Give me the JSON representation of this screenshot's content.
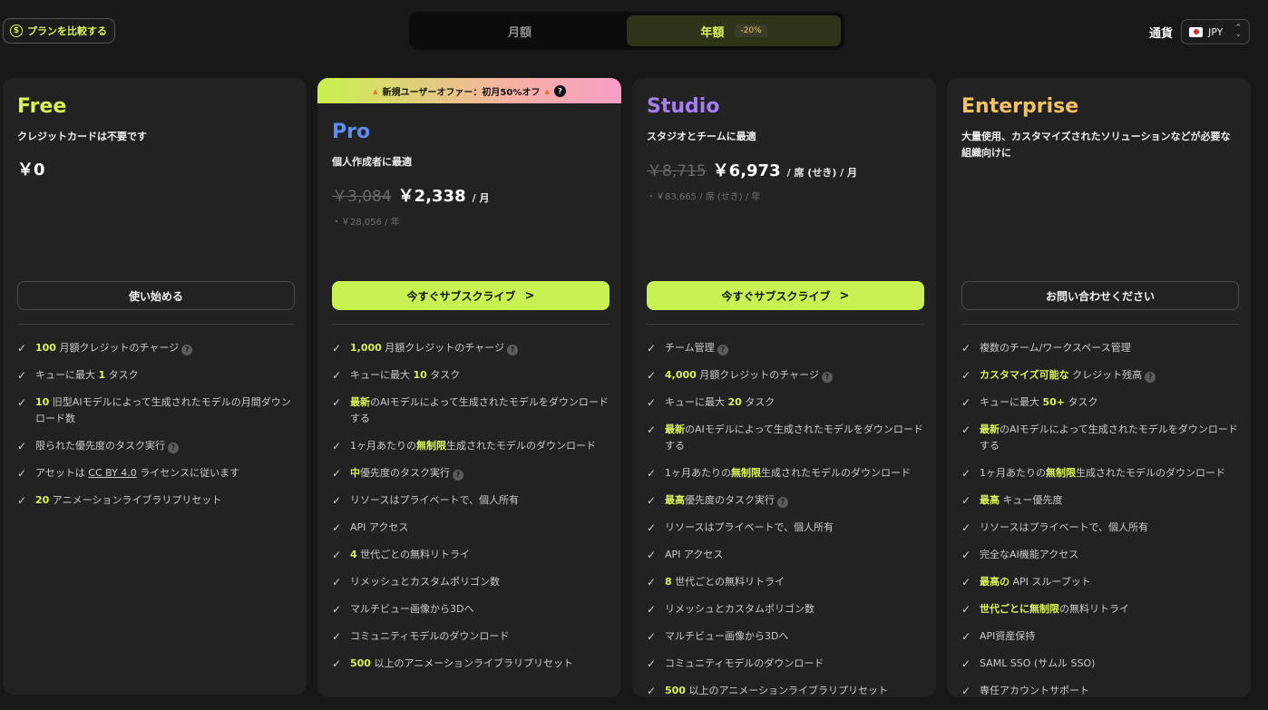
{
  "header": {
    "compare_label": "プランを比較する",
    "billing": {
      "monthly": "月額",
      "yearly": "年額",
      "yearly_badge": "-20%",
      "active": "yearly"
    },
    "currency": {
      "label": "通貨",
      "value": "JPY"
    }
  },
  "colors": {
    "accent": "#c8f251",
    "free": "#d7f35a",
    "pro": "#5f8cf5",
    "studio": "#a77ef7",
    "enterprise": "#f2c166"
  },
  "plans": {
    "free": {
      "name": "Free",
      "desc": "クレジットカードは不要です",
      "price": "￥0",
      "cta": "使い始める",
      "features": [
        [
          {
            "t": "100",
            "h": true
          },
          {
            "t": " 月額クレジットのチャージ"
          },
          {
            "i": true
          }
        ],
        [
          {
            "t": "キューに最大 "
          },
          {
            "t": "1",
            "h": true
          },
          {
            "t": " タスク"
          }
        ],
        [
          {
            "t": "10",
            "h": true
          },
          {
            "t": " 旧型AIモデルによって生成されたモデルの月間ダウンロード数"
          }
        ],
        [
          {
            "t": "限られた優先度のタスク実行"
          },
          {
            "i": true
          }
        ],
        [
          {
            "t": "アセットは "
          },
          {
            "t": "CC BY 4.0",
            "u": true
          },
          {
            "t": " ライセンスに従います"
          }
        ],
        [
          {
            "t": "20",
            "h": true
          },
          {
            "t": " アニメーションライブラリプリセット"
          }
        ]
      ]
    },
    "pro": {
      "offer": "新規ユーザーオファー：初月50%オフ",
      "name": "Pro",
      "desc": "個人作成者に最適",
      "price_old": "￥3,084",
      "price_new": "￥2,338",
      "per": "/ 月",
      "sub": "・￥28,056 / 年",
      "cta": "今すぐサブスクライブ",
      "features": [
        [
          {
            "t": "1,000",
            "h": true
          },
          {
            "t": " 月額クレジットのチャージ"
          },
          {
            "i": true
          }
        ],
        [
          {
            "t": "キューに最大 "
          },
          {
            "t": "10",
            "h": true
          },
          {
            "t": " タスク"
          }
        ],
        [
          {
            "t": "最新",
            "h": true
          },
          {
            "t": "のAIモデルによって生成されたモデルをダウンロードする"
          }
        ],
        [
          {
            "t": "1ヶ月あたりの"
          },
          {
            "t": "無制限",
            "h": true
          },
          {
            "t": "生成されたモデルのダウンロード"
          }
        ],
        [
          {
            "t": "中",
            "h": true
          },
          {
            "t": "優先度のタスク実行"
          },
          {
            "i": true
          }
        ],
        [
          {
            "t": "リソースはプライベートで、個人所有"
          }
        ],
        [
          {
            "t": "API アクセス"
          }
        ],
        [
          {
            "t": "4",
            "h": true
          },
          {
            "t": " 世代ごとの無料リトライ"
          }
        ],
        [
          {
            "t": "リメッシュとカスタムポリゴン数"
          }
        ],
        [
          {
            "t": "マルチビュー画像から3Dへ"
          }
        ],
        [
          {
            "t": "コミュニティモデルのダウンロード"
          }
        ],
        [
          {
            "t": "500",
            "h": true
          },
          {
            "t": " 以上のアニメーションライブラリプリセット"
          }
        ]
      ]
    },
    "studio": {
      "name": "Studio",
      "desc": "スタジオとチームに最適",
      "price_old": "￥8,715",
      "price_new": "￥6,973",
      "per": "/ 席 (せき) / 月",
      "sub": "・￥83,665 / 席 (せき) / 年",
      "cta": "今すぐサブスクライブ",
      "features": [
        [
          {
            "t": "チーム管理"
          },
          {
            "i": true
          }
        ],
        [
          {
            "t": "4,000",
            "h": true
          },
          {
            "t": " 月額クレジットのチャージ"
          },
          {
            "i": true
          }
        ],
        [
          {
            "t": "キューに最大 "
          },
          {
            "t": "20",
            "h": true
          },
          {
            "t": " タスク"
          }
        ],
        [
          {
            "t": "最新",
            "h": true
          },
          {
            "t": "のAIモデルによって生成されたモデルをダウンロードする"
          }
        ],
        [
          {
            "t": "1ヶ月あたりの"
          },
          {
            "t": "無制限",
            "h": true
          },
          {
            "t": "生成されたモデルのダウンロード"
          }
        ],
        [
          {
            "t": "最高",
            "h": true
          },
          {
            "t": "優先度のタスク実行"
          },
          {
            "i": true
          }
        ],
        [
          {
            "t": "リソースはプライベートで、個人所有"
          }
        ],
        [
          {
            "t": "API アクセス"
          }
        ],
        [
          {
            "t": "8",
            "h": true
          },
          {
            "t": " 世代ごとの無料リトライ"
          }
        ],
        [
          {
            "t": "リメッシュとカスタムポリゴン数"
          }
        ],
        [
          {
            "t": "マルチビュー画像から3Dへ"
          }
        ],
        [
          {
            "t": "コミュニティモデルのダウンロード"
          }
        ],
        [
          {
            "t": "500",
            "h": true
          },
          {
            "t": " 以上のアニメーションライブラリプリセット"
          }
        ]
      ]
    },
    "enterprise": {
      "name": "Enterprise",
      "desc": "大量使用、カスタマイズされたソリューションなどが必要な組織向けに",
      "cta": "お問い合わせください",
      "features": [
        [
          {
            "t": "複数のチーム/ワークスペース管理"
          }
        ],
        [
          {
            "t": "カスタマイズ可能な",
            "h": true
          },
          {
            "t": " クレジット残高"
          },
          {
            "i": true
          }
        ],
        [
          {
            "t": "キューに最大 "
          },
          {
            "t": "50+",
            "h": true
          },
          {
            "t": " タスク"
          }
        ],
        [
          {
            "t": "最新",
            "h": true
          },
          {
            "t": "のAIモデルによって生成されたモデルをダウンロードする"
          }
        ],
        [
          {
            "t": "1ヶ月あたりの"
          },
          {
            "t": "無制限",
            "h": true
          },
          {
            "t": "生成されたモデルのダウンロード"
          }
        ],
        [
          {
            "t": "最高",
            "h": true
          },
          {
            "t": " キュー優先度"
          }
        ],
        [
          {
            "t": "リソースはプライベートで、個人所有"
          }
        ],
        [
          {
            "t": "完全なAI機能アクセス"
          }
        ],
        [
          {
            "t": "最高の",
            "h": true
          },
          {
            "t": " API スループット"
          }
        ],
        [
          {
            "t": "世代ごとに無制限",
            "h": true
          },
          {
            "t": "の無料リトライ"
          }
        ],
        [
          {
            "t": "API資産保持"
          }
        ],
        [
          {
            "t": "SAML SSO (サムル SSO)"
          }
        ],
        [
          {
            "t": "専任アカウントサポート"
          }
        ]
      ]
    }
  }
}
